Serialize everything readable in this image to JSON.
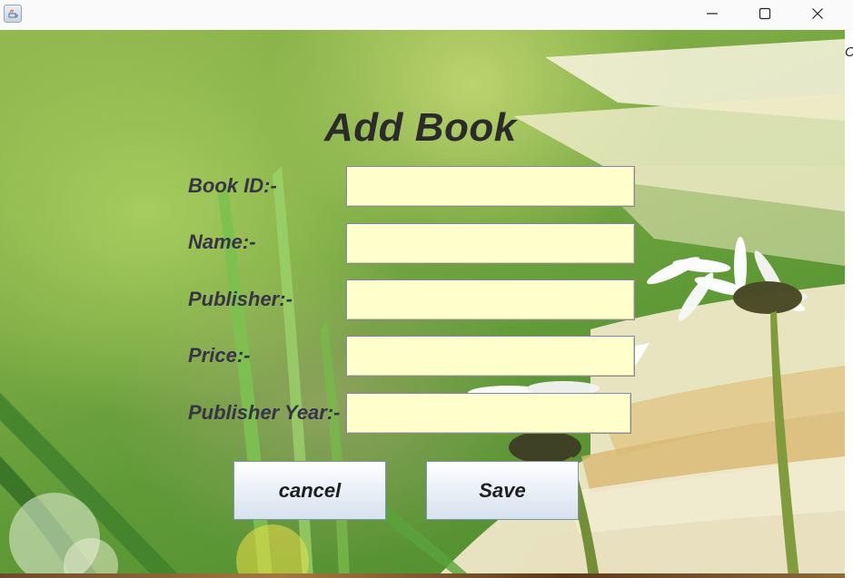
{
  "window": {
    "app_icon": "java-icon",
    "controls": {
      "minimize": "minimize-icon",
      "maximize": "maximize-icon",
      "close": "close-icon"
    }
  },
  "background": {
    "edge_text": "Ce"
  },
  "form": {
    "title": "Add Book",
    "fields": [
      {
        "label": "Book ID:-",
        "value": ""
      },
      {
        "label": "Name:-",
        "value": ""
      },
      {
        "label": "Publisher:-",
        "value": ""
      },
      {
        "label": "Price:-",
        "value": ""
      },
      {
        "label": "Publisher Year:-",
        "value": ""
      }
    ],
    "buttons": {
      "cancel": "cancel",
      "save": "Save"
    }
  },
  "colors": {
    "input_bg": "#ffffcc",
    "label_text": "#373446",
    "title_text": "#2b2b2b"
  }
}
